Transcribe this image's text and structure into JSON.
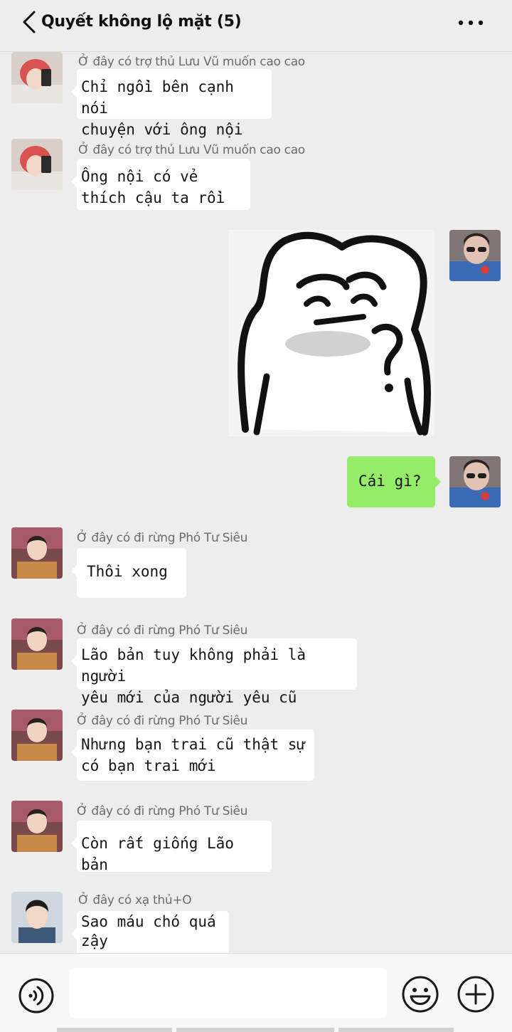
{
  "header": {
    "title": "Quyết không lộ mặt (5)"
  },
  "messages": [
    {
      "sender": "Ở đây có trợ thủ Lưu Vũ muốn cao cao",
      "text": "Chỉ ngồi bên cạnh nói\nchuyện với ông nội"
    },
    {
      "sender": "Ở đây có trợ thủ Lưu Vũ muốn cao cao",
      "text": "Ông nội có vẻ\nthích cậu ta rồi"
    },
    {
      "sender": "",
      "text": ""
    },
    {
      "sender": "",
      "text": "Cái gì?"
    },
    {
      "sender": "Ở đây có đi rừng Phó Tư Siêu",
      "text": "Thôi xong"
    },
    {
      "sender": "Ở đây có đi rừng Phó Tư Siêu",
      "text": "Lão bản tuy không phải là người\nyêu mới của người yêu cũ"
    },
    {
      "sender": "Ở đây có đi rừng Phó Tư Siêu",
      "text": "Nhưng bạn trai cũ thật sự\ncó bạn trai mới"
    },
    {
      "sender": "Ở đây có đi rừng Phó Tư Siêu",
      "text": "Còn rất giống Lão bản"
    },
    {
      "sender": "Ở đây có xạ thủ+O",
      "text": "Sao máu chó quá\nzậy"
    }
  ],
  "input": {
    "placeholder": ""
  },
  "colors": {
    "background": "#ededed",
    "bubble_self": "#95ec69",
    "bubble_other": "#ffffff",
    "header_text": "#111111",
    "sender_text": "#6b6b6b"
  },
  "icons": [
    "back-icon",
    "more-icon",
    "voice-icon",
    "emoji-icon",
    "plus-icon"
  ]
}
